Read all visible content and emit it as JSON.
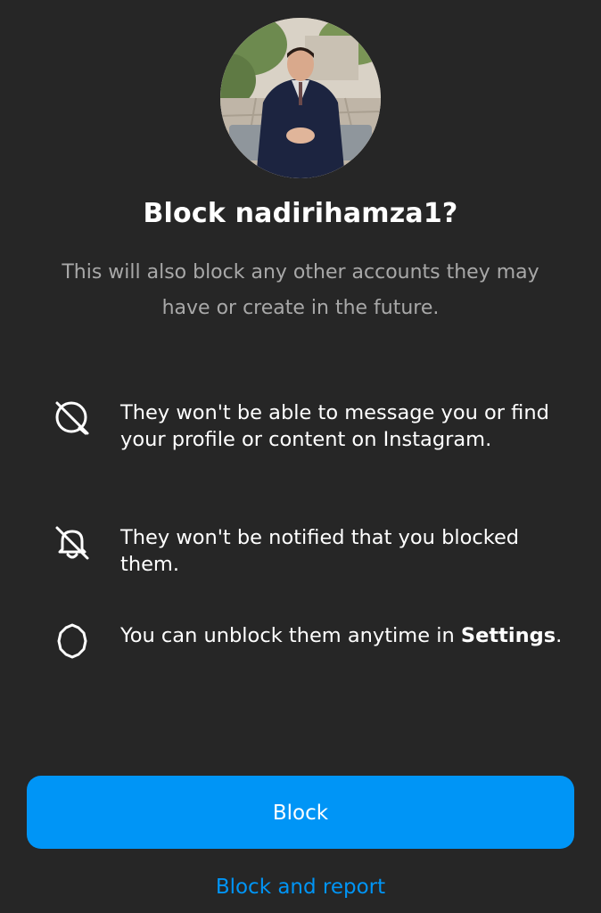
{
  "dialog": {
    "title": "Block nadirihamza1?",
    "subtitle": "This will also block any other accounts they may have or create in the future."
  },
  "info_items": [
    {
      "icon": "message-blocked-icon",
      "text": "They won't be able to message you or find your profile or content on Instagram."
    },
    {
      "icon": "notification-off-icon",
      "text": "They won't be notified that you blocked them."
    },
    {
      "icon": "settings-gear-icon",
      "text_before": "You can unblock them anytime in ",
      "text_bold": "Settings",
      "text_after": "."
    }
  ],
  "actions": {
    "block_label": "Block",
    "block_and_report_label": "Block and report"
  },
  "colors": {
    "background": "#262626",
    "primary": "#0095f6",
    "secondary_text": "#a8a8a8"
  }
}
